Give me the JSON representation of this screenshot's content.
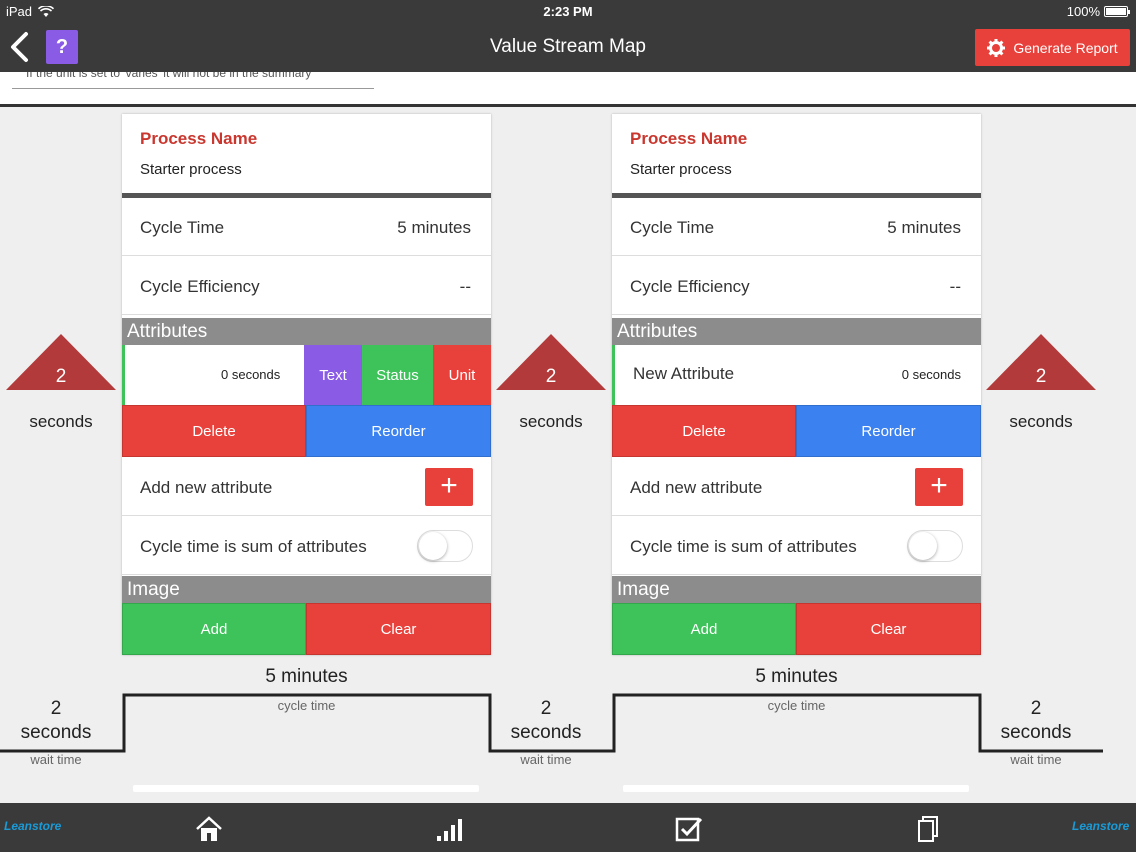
{
  "status_bar": {
    "device": "iPad",
    "time": "2:23 PM",
    "battery": "100%",
    "battery_level": 1.0
  },
  "nav": {
    "title": "Value Stream Map",
    "help_label": "?",
    "generate_label": "Generate Report"
  },
  "top_hint": "If the unit is set to 'varies' it will not be in the summary",
  "cards": [
    {
      "process_label": "Process Name",
      "process_value": "Starter process",
      "cycle_time_label": "Cycle Time",
      "cycle_time_value": "5 minutes",
      "efficiency_label": "Cycle Efficiency",
      "efficiency_value": "--",
      "attributes_header": "Attributes",
      "attribute_name": "",
      "attribute_value": "0 seconds",
      "swipe_actions": {
        "text": "Text",
        "status": "Status",
        "unit": "Unit"
      },
      "delete_label": "Delete",
      "reorder_label": "Reorder",
      "add_attr_label": "Add new attribute",
      "plus_label": "+",
      "toggle_label": "Cycle time is sum of attributes",
      "toggle_on": false,
      "image_header": "Image",
      "add_label": "Add",
      "clear_label": "Clear"
    },
    {
      "process_label": "Process Name",
      "process_value": "Starter process",
      "cycle_time_label": "Cycle Time",
      "cycle_time_value": "5 minutes",
      "efficiency_label": "Cycle Efficiency",
      "efficiency_value": "--",
      "attributes_header": "Attributes",
      "attribute_name": "New Attribute",
      "attribute_value": "0 seconds",
      "delete_label": "Delete",
      "reorder_label": "Reorder",
      "add_attr_label": "Add new attribute",
      "plus_label": "+",
      "toggle_label": "Cycle time is sum of attributes",
      "toggle_on": false,
      "image_header": "Image",
      "add_label": "Add",
      "clear_label": "Clear"
    }
  ],
  "inventory": [
    {
      "value": "2",
      "unit": "seconds"
    },
    {
      "value": "2",
      "unit": "seconds"
    },
    {
      "value": "2",
      "unit": "seconds"
    }
  ],
  "timeline": {
    "cycles": [
      {
        "value": "5 minutes",
        "label": "cycle time"
      },
      {
        "value": "5 minutes",
        "label": "cycle time"
      }
    ],
    "waits": [
      {
        "value": "2",
        "unit": "seconds",
        "label": "wait time"
      },
      {
        "value": "2",
        "unit": "seconds",
        "label": "wait time"
      },
      {
        "value": "2",
        "unit": "seconds",
        "label": "wait time"
      }
    ]
  },
  "tabs": [
    "home-icon",
    "chart-bars-icon",
    "checkbox-icon",
    "documents-icon"
  ],
  "logo_text": "Leanstore",
  "colors": {
    "accent_red": "#e8403a",
    "title_red": "#c9372f",
    "green": "#3ec35a",
    "blue": "#3b82f0",
    "purple": "#8a5ce6",
    "triangle": "#b23a3a"
  }
}
